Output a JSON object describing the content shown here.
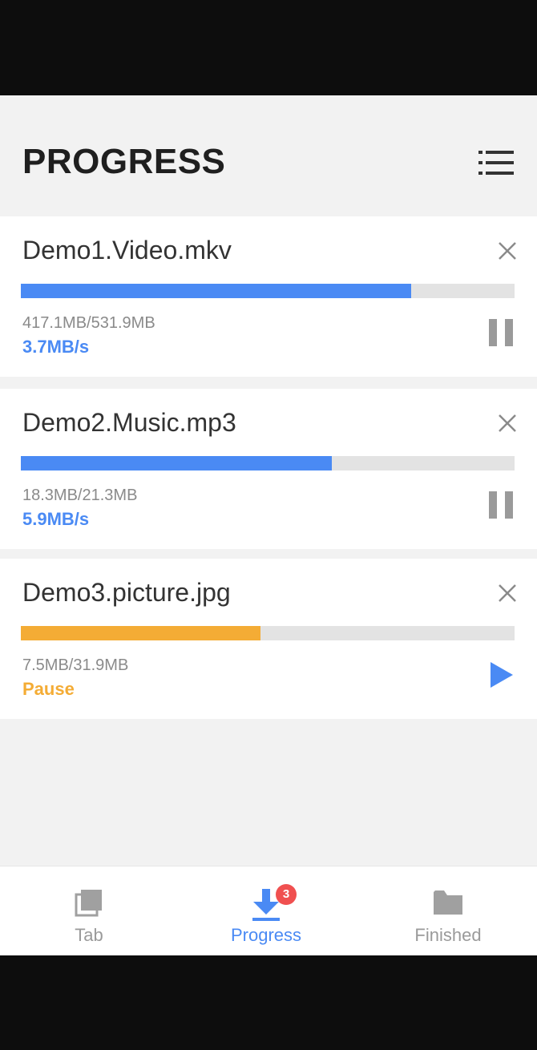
{
  "header": {
    "title": "PROGRESS",
    "menu_icon": "list-menu-icon"
  },
  "colors": {
    "accent_blue": "#4a8af4",
    "paused_orange": "#f4ac35",
    "inactive_gray": "#9a9a9a"
  },
  "downloads": [
    {
      "name": "Demo1.Video.mkv",
      "size": "417.1MB/531.9MB",
      "status": "3.7MB/s",
      "progress": 0.79,
      "state": "downloading",
      "action_icon": "pause-icon"
    },
    {
      "name": "Demo2.Music.mp3",
      "size": "18.3MB/21.3MB",
      "status": "5.9MB/s",
      "progress": 0.63,
      "state": "downloading",
      "action_icon": "pause-icon"
    },
    {
      "name": "Demo3.picture.jpg",
      "size": "7.5MB/31.9MB",
      "status": "Pause",
      "progress": 0.486,
      "state": "paused",
      "action_icon": "play-icon"
    }
  ],
  "bottom_nav": {
    "items": [
      {
        "label": "Tab",
        "icon": "tabs-icon",
        "active": false
      },
      {
        "label": "Progress",
        "icon": "download-icon",
        "active": true,
        "badge": "3"
      },
      {
        "label": "Finished",
        "icon": "folder-icon",
        "active": false
      }
    ]
  }
}
